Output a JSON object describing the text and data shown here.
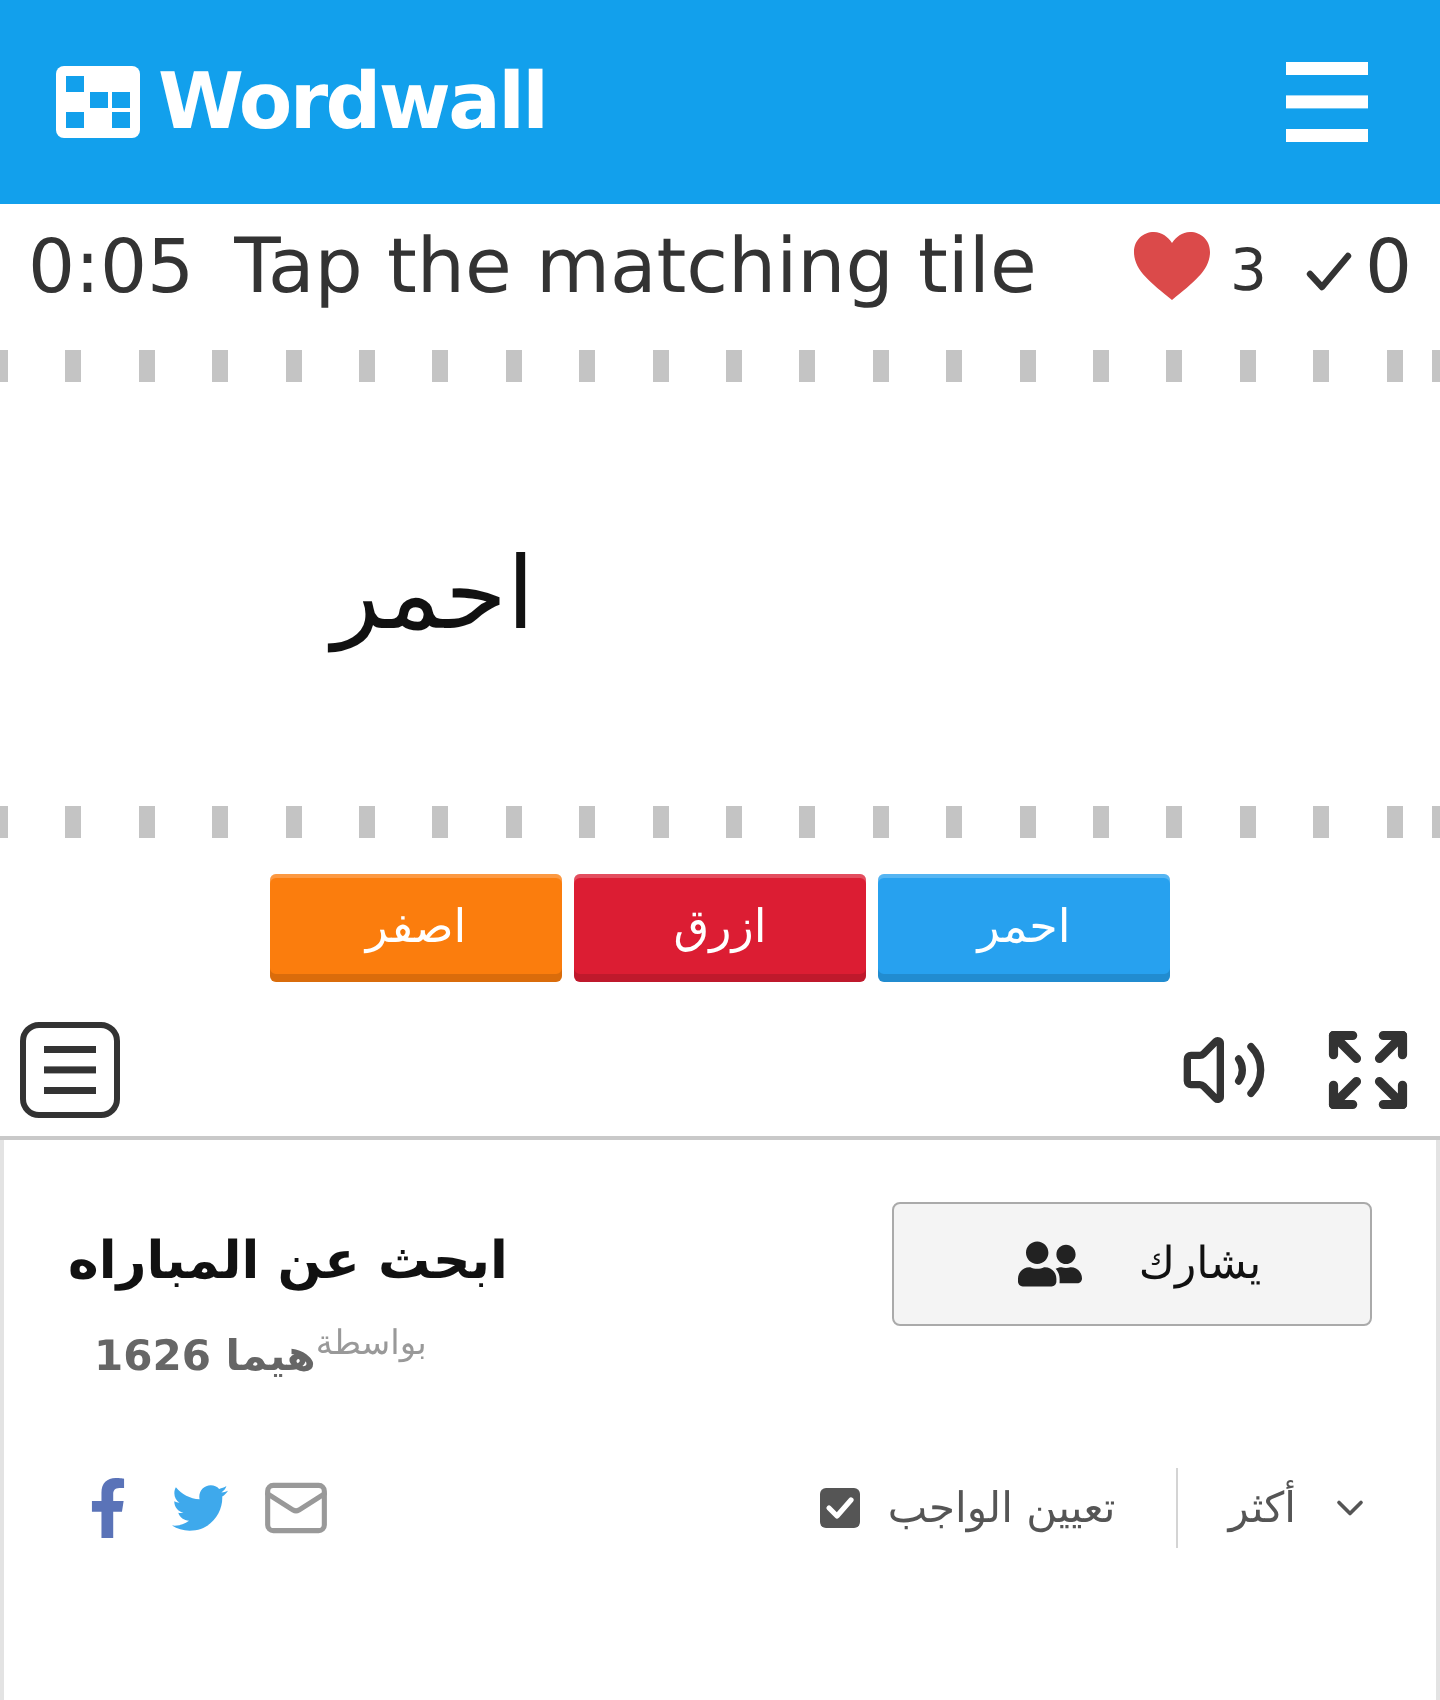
{
  "header": {
    "logo": "Wordwall"
  },
  "game": {
    "timer": "0:05",
    "instruction": "Tap the matching tile",
    "lives": "3",
    "score": "0",
    "prompt": "احمر",
    "tiles": [
      {
        "label": "احمر",
        "color": "#27a1ef"
      },
      {
        "label": "ازرق",
        "color": "#dc1d33"
      },
      {
        "label": "اصفر",
        "color": "#fb7d0d"
      }
    ]
  },
  "activity": {
    "title": "ابحث عن المباراه",
    "author": "$^{بواسطة}$**هيما 1626**",
    "share_button": "يشارك",
    "assign": {
      "label": "تعيين الواجب",
      "checked": true
    },
    "more": "أكثر"
  }
}
